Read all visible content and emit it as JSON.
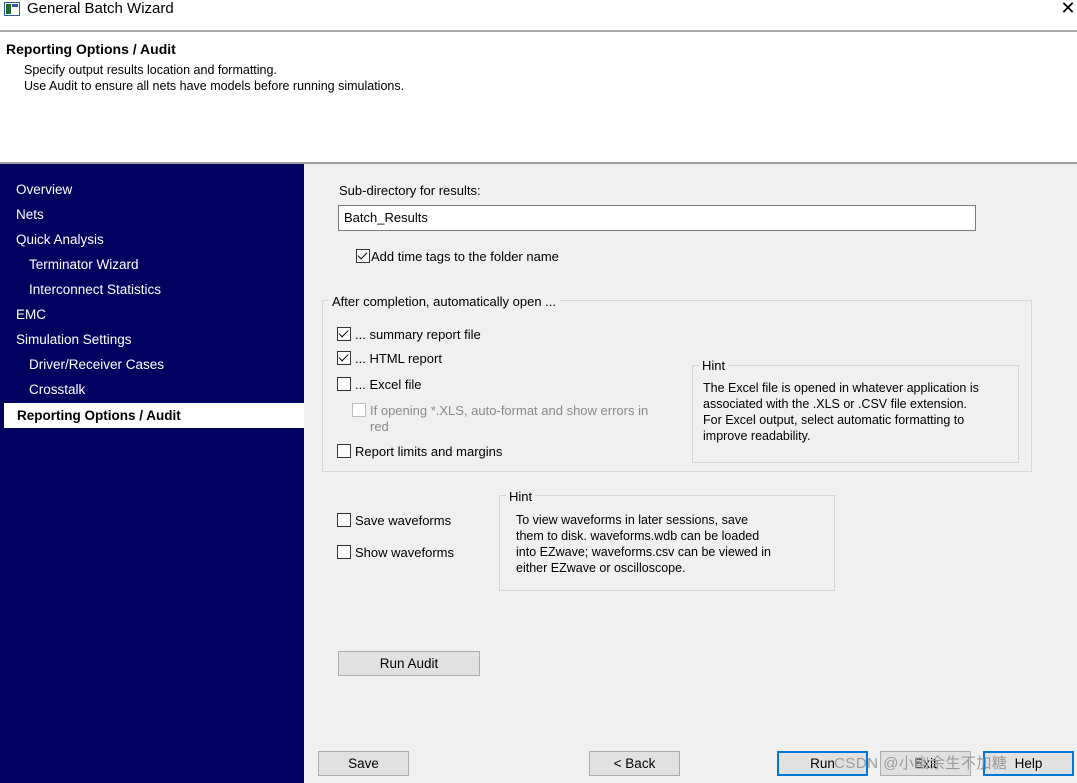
{
  "window": {
    "title": "General Batch Wizard",
    "close_glyph": "✕"
  },
  "header": {
    "title": "Reporting Options / Audit",
    "line1": "Specify output results location and formatting.",
    "line2": "Use Audit to ensure all nets have models before running simulations."
  },
  "sidebar": {
    "items": [
      {
        "label": "Overview"
      },
      {
        "label": "Nets"
      },
      {
        "label": "Quick Analysis"
      },
      {
        "label": "Terminator Wizard"
      },
      {
        "label": "Interconnect Statistics"
      },
      {
        "label": "EMC"
      },
      {
        "label": "Simulation Settings"
      },
      {
        "label": "Driver/Receiver Cases"
      },
      {
        "label": "Crosstalk"
      },
      {
        "label": "Reporting Options / Audit"
      }
    ]
  },
  "form": {
    "subdir_label": "Sub-directory for results:",
    "subdir_value": "Batch_Results",
    "time_tags_label": "Add time tags to the folder name",
    "after_group_title": "After completion, automatically open ...",
    "summary_label": "... summary report file",
    "html_label": "... HTML report",
    "excel_label": "... Excel file",
    "xls_line1": "If opening *.XLS, auto-format and show errors in",
    "xls_line2": "red",
    "limits_label": "Report limits and margins",
    "hint1_title": "Hint",
    "hint1_lines": [
      "The Excel file is opened in whatever application is",
      "associated with the .XLS or .CSV file extension.",
      "For Excel output, select automatic formatting to",
      "improve readability."
    ],
    "save_wave_label": "Save waveforms",
    "show_wave_label": "Show waveforms",
    "hint2_title": "Hint",
    "hint2_lines": [
      "To view waveforms in later sessions, save",
      "them to disk. waveforms.wdb can be loaded",
      "into EZwave; waveforms.csv can be viewed in",
      "either EZwave or oscilloscope."
    ],
    "run_audit_label": "Run Audit"
  },
  "footer": {
    "save_label": "Save",
    "back_label": "< Back",
    "run_label": "Run",
    "exit_label": "Exit",
    "help_label": "Help"
  },
  "watermark": "CSDN @小幽余生不加糖"
}
